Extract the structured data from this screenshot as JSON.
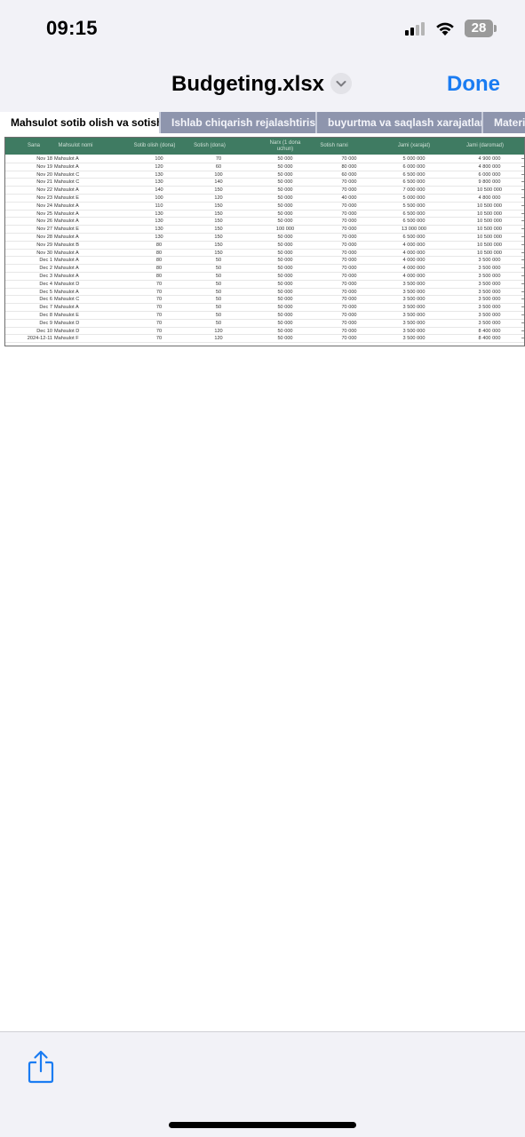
{
  "status": {
    "time": "09:15",
    "battery": "28",
    "battery_level": 0.28
  },
  "nav": {
    "title": "Budgeting.xlsx",
    "done_label": "Done"
  },
  "tabs": [
    {
      "label": "Mahsulot sotib olish va sotish",
      "active": true
    },
    {
      "label": "Ishlab chiqarish rejalashtirish",
      "active": false
    },
    {
      "label": "buyurtma va saqlash xarajatlari",
      "active": false
    },
    {
      "label": "Materi",
      "active": false
    }
  ],
  "sheet": {
    "headers": [
      "Sana",
      "Mahsulot nomi",
      "Sotib olish (dona)",
      "Sotish (dona)",
      "Narx (1 dona uchun)",
      "Sotish narxi",
      "Jami (xarajat)",
      "Jami (daromad)"
    ],
    "rows": [
      [
        "Nov 18",
        "Mahsulot A",
        "100",
        "70",
        "50 000",
        "70 000",
        "5 000 000",
        "4 900 000"
      ],
      [
        "Nov 19",
        "Mahsulot A",
        "120",
        "60",
        "50 000",
        "80 000",
        "6 000 000",
        "4 800 000"
      ],
      [
        "Nov 20",
        "Mahsulot C",
        "130",
        "100",
        "50 000",
        "60 000",
        "6 500 000",
        "6 000 000"
      ],
      [
        "Nov 21",
        "Mahsulot C",
        "130",
        "140",
        "50 000",
        "70 000",
        "6 500 000",
        "9 800 000"
      ],
      [
        "Nov 22",
        "Mahsulot A",
        "140",
        "150",
        "50 000",
        "70 000",
        "7 000 000",
        "10 500 000"
      ],
      [
        "Nov 23",
        "Mahsulot E",
        "100",
        "120",
        "50 000",
        "40 000",
        "5 000 000",
        "4 800 000"
      ],
      [
        "Nov 24",
        "Mahsulot A",
        "110",
        "150",
        "50 000",
        "70 000",
        "5 500 000",
        "10 500 000"
      ],
      [
        "Nov 25",
        "Mahsulot A",
        "130",
        "150",
        "50 000",
        "70 000",
        "6 500 000",
        "10 500 000"
      ],
      [
        "Nov 26",
        "Mahsulot A",
        "130",
        "150",
        "50 000",
        "70 000",
        "6 500 000",
        "10 500 000"
      ],
      [
        "Nov 27",
        "Mahsulot E",
        "130",
        "150",
        "100 000",
        "70 000",
        "13 000 000",
        "10 500 000"
      ],
      [
        "Nov 28",
        "Mahsulot A",
        "130",
        "150",
        "50 000",
        "70 000",
        "6 500 000",
        "10 500 000"
      ],
      [
        "Nov 29",
        "Mahsulot B",
        "80",
        "150",
        "50 000",
        "70 000",
        "4 000 000",
        "10 500 000"
      ],
      [
        "Nov 30",
        "Mahsulot A",
        "80",
        "150",
        "50 000",
        "70 000",
        "4 000 000",
        "10 500 000"
      ],
      [
        "Dec 1",
        "Mahsulot A",
        "80",
        "50",
        "50 000",
        "70 000",
        "4 000 000",
        "3 500 000"
      ],
      [
        "Dec 2",
        "Mahsulot A",
        "80",
        "50",
        "50 000",
        "70 000",
        "4 000 000",
        "3 500 000"
      ],
      [
        "Dec 3",
        "Mahsulot A",
        "80",
        "50",
        "50 000",
        "70 000",
        "4 000 000",
        "3 500 000"
      ],
      [
        "Dec 4",
        "Mahsulot D",
        "70",
        "50",
        "50 000",
        "70 000",
        "3 500 000",
        "3 500 000"
      ],
      [
        "Dec 5",
        "Mahsulot A",
        "70",
        "50",
        "50 000",
        "70 000",
        "3 500 000",
        "3 500 000"
      ],
      [
        "Dec 6",
        "Mahsulot C",
        "70",
        "50",
        "50 000",
        "70 000",
        "3 500 000",
        "3 500 000"
      ],
      [
        "Dec 7",
        "Mahsulot A",
        "70",
        "50",
        "50 000",
        "70 000",
        "3 500 000",
        "3 500 000"
      ],
      [
        "Dec 8",
        "Mahsulot E",
        "70",
        "50",
        "50 000",
        "70 000",
        "3 500 000",
        "3 500 000"
      ],
      [
        "Dec 9",
        "Mahsulot D",
        "70",
        "50",
        "50 000",
        "70 000",
        "3 500 000",
        "3 500 000"
      ],
      [
        "Dec 10",
        "Mahsulot D",
        "70",
        "120",
        "50 000",
        "70 000",
        "3 500 000",
        "8 400 000"
      ],
      [
        "2024-12-11",
        "Mahsulot F",
        "70",
        "120",
        "50 000",
        "70 000",
        "3 500 000",
        "8 400 000"
      ]
    ]
  },
  "colors": {
    "accent": "#1a7cf2",
    "header_green": "#3f7b62",
    "tab_inactive": "#8e95ad"
  },
  "toolbar": {
    "share_icon": "share-icon"
  }
}
